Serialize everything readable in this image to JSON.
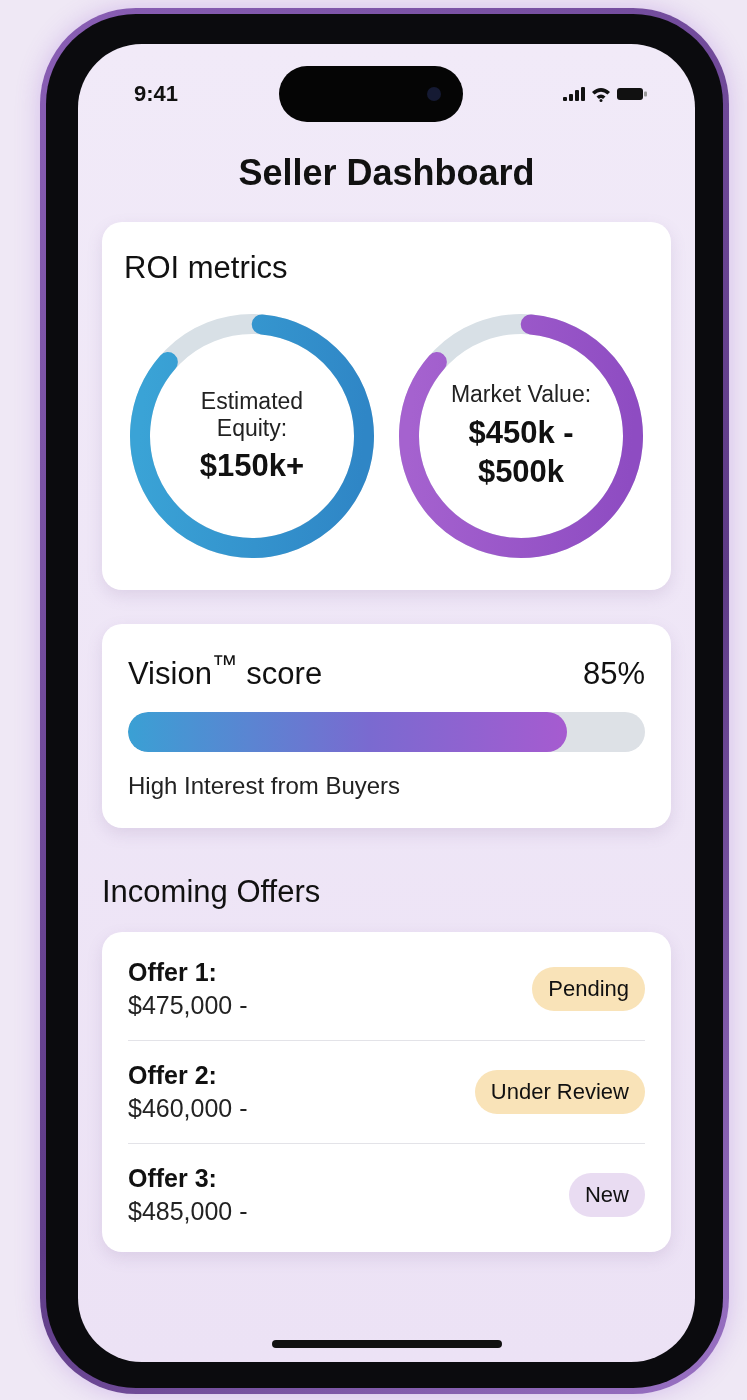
{
  "status_bar": {
    "time": "9:41"
  },
  "title": "Seller Dashboard",
  "roi_metrics": {
    "title": "ROI metrics",
    "rings": [
      {
        "kind": "blue",
        "label": "Estimated Equity:",
        "value": "$150k+",
        "level": 0.85
      },
      {
        "kind": "purple",
        "label": "Market Value:",
        "value": "$450k - $500k",
        "level": 0.85
      }
    ]
  },
  "vision_score": {
    "title": "Vision$^{™}$ score",
    "reading": "85%",
    "level": 0.85,
    "caption": "High Interest from Buyers"
  },
  "offers": {
    "title": "Incoming Offers",
    "items": [
      {
        "name": "Offer 1:",
        "amount": "$475,000 -",
        "status": "Pending",
        "color": "#f9e3b8"
      },
      {
        "name": "Offer 2:",
        "amount": "$460,000 -",
        "status": "Under Review",
        "color": "#f9e3b8"
      },
      {
        "name": "Offer 3:",
        "amount": "$485,000 -",
        "status": "New",
        "color": "#e9dcf2"
      }
    ]
  }
}
